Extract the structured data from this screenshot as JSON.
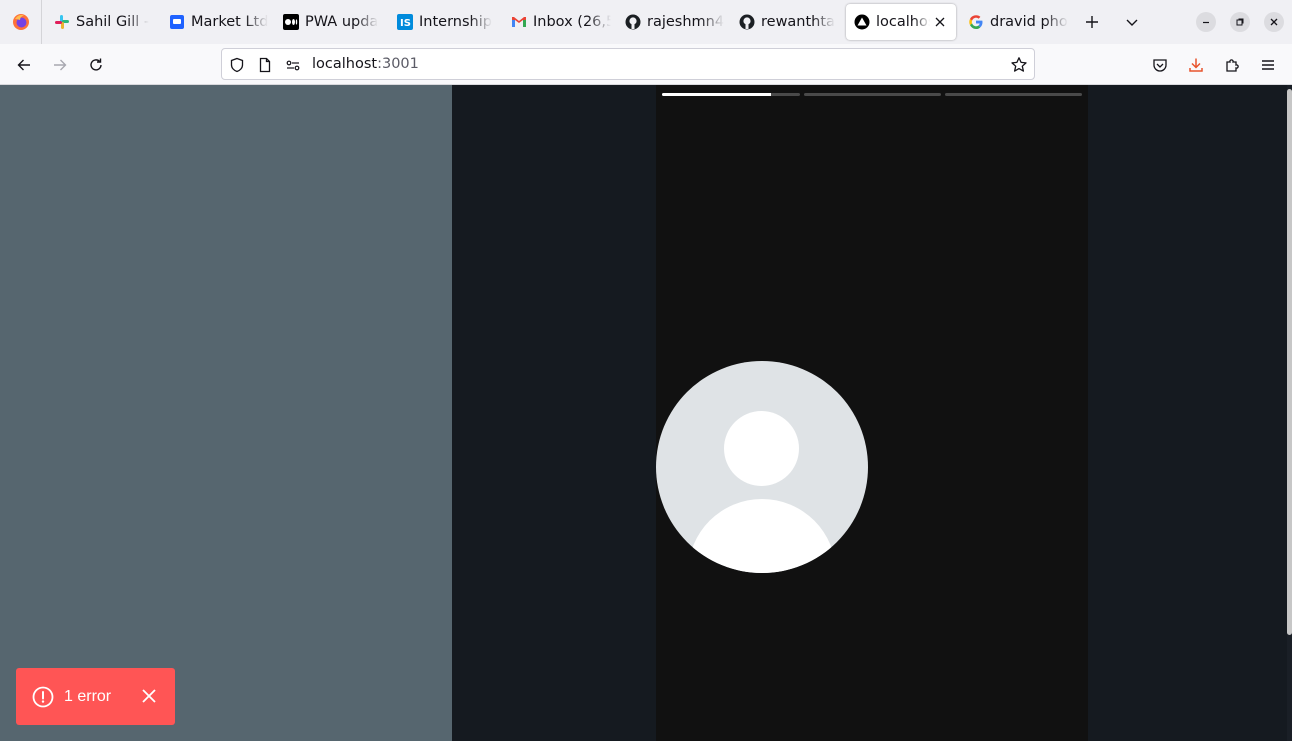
{
  "tabs": [
    {
      "label": "Sahil Gill - ",
      "icon": "slack-icon"
    },
    {
      "label": "Market Ltd",
      "icon": "chat-app-icon"
    },
    {
      "label": "PWA upda",
      "icon": "medium-icon"
    },
    {
      "label": "Internship",
      "icon": "internshala-icon"
    },
    {
      "label": "Inbox (26,5",
      "icon": "gmail-icon"
    },
    {
      "label": "rajeshmn4",
      "icon": "github-icon"
    },
    {
      "label": "rewanthta",
      "icon": "github-icon"
    },
    {
      "label": "localhost",
      "icon": "vercel-triangle-icon",
      "active": true
    },
    {
      "label": "dravid pho",
      "icon": "google-icon"
    }
  ],
  "url": {
    "host": "localhost",
    "port": ":3001"
  },
  "story": {
    "segments": [
      0.79,
      0,
      0
    ]
  },
  "toast": {
    "label": "1 error"
  },
  "colors": {
    "left_pane": "#56666f",
    "right_pane": "#151a20",
    "story_bg": "#111111",
    "toast_bg": "#ff5555",
    "avatar_bg": "#dfe3e6"
  }
}
